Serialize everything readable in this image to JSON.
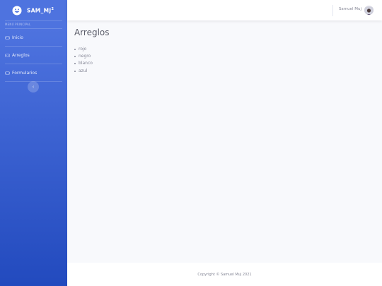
{
  "brand": {
    "name": "SAM_MJ",
    "superscript": "2"
  },
  "sidebar": {
    "heading": "MENÚ PRINCIPAL",
    "items": [
      {
        "label": "Inicio",
        "icon": "gamepad-icon"
      },
      {
        "label": "Arreglos",
        "icon": "gamepad-icon"
      },
      {
        "label": "Formularios",
        "icon": "gamepad-icon"
      }
    ],
    "toggle_glyph": "‹"
  },
  "topbar": {
    "user_name": "Samuel Muj"
  },
  "main": {
    "title": "Arreglos",
    "list": [
      "rojo",
      "negro",
      "blanco",
      "azul"
    ]
  },
  "footer": {
    "text": "Copyright © Samuel Muj 2021"
  },
  "colors": {
    "sidebar_top": "#4e73df",
    "sidebar_bottom": "#224abe",
    "page_bg": "#f8f9fc",
    "text_muted": "#858796",
    "title": "#5a5c69"
  }
}
